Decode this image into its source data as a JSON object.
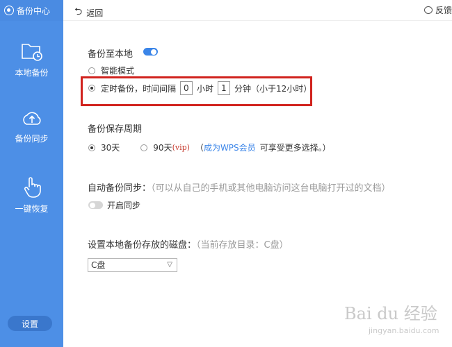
{
  "sidebar": {
    "title": "备份中心",
    "items": [
      {
        "label": "本地备份"
      },
      {
        "label": "备份同步"
      },
      {
        "label": "一键恢复"
      }
    ],
    "settings_label": "设置"
  },
  "topbar": {
    "back_label": "返回",
    "feedback_label": "反馈"
  },
  "local_backup": {
    "title": "备份至本地",
    "enabled": true,
    "smart_mode_label": "智能模式",
    "timed_prefix": "定时备份，时间间隔",
    "hours_value": "0",
    "hours_unit": "小时",
    "minutes_value": "1",
    "minutes_unit": "分钟（小于12小时）",
    "selected_mode": "timed"
  },
  "retention": {
    "title": "备份保存周期",
    "option_30": "30天",
    "option_90": "90天",
    "vip_tag": "(vip)",
    "note_open": "（",
    "member_link": "成为WPS会员",
    "note_rest": "可享受更多选择。）"
  },
  "auto_sync": {
    "title": "自动备份同步：",
    "hint": "（可以从自己的手机或其他电脑访问这台电脑打开过的文档）",
    "toggle_label": "开启同步",
    "enabled": false
  },
  "disk": {
    "title": "设置本地备份存放的磁盘：",
    "hint": "（当前存放目录：C盘）",
    "selected": "C盘"
  },
  "watermark": {
    "main": "Bai du 经验",
    "sub": "jingyan.baidu.com"
  },
  "colors": {
    "sidebar": "#4d8fe6",
    "accent": "#3b85e8",
    "highlight_box": "#d1231e"
  }
}
